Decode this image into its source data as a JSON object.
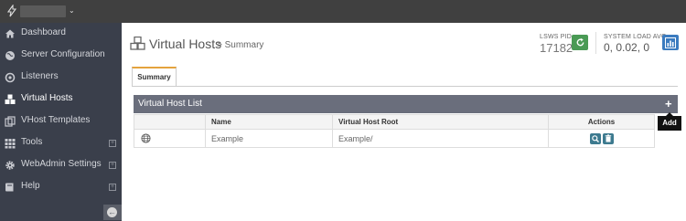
{
  "topbar": {
    "user_name": "",
    "caret": "⌄"
  },
  "sidebar": {
    "items": [
      {
        "label": "Dashboard",
        "icon": "home-icon",
        "expandable": false
      },
      {
        "label": "Server Configuration",
        "icon": "globe-icon",
        "expandable": false
      },
      {
        "label": "Listeners",
        "icon": "link-icon",
        "expandable": false
      },
      {
        "label": "Virtual Hosts",
        "icon": "cubes-icon",
        "expandable": false,
        "active": true
      },
      {
        "label": "VHost Templates",
        "icon": "copy-icon",
        "expandable": false
      },
      {
        "label": "Tools",
        "icon": "grid-icon",
        "expandable": true
      },
      {
        "label": "WebAdmin Settings",
        "icon": "gear-icon",
        "expandable": true
      },
      {
        "label": "Help",
        "icon": "book-icon",
        "expandable": true
      }
    ],
    "expand_glyph": "+",
    "collapse_glyph": "←"
  },
  "header": {
    "title": "Virtual Hosts",
    "subtitle": " > Summary",
    "pid_label": "LSWS PID",
    "pid_value": "17182",
    "load_label": "SYSTEM LOAD AVG",
    "load_value": "0, 0.02, 0"
  },
  "tabs": [
    {
      "label": "Summary",
      "active": true
    }
  ],
  "panel": {
    "title": "Virtual Host List",
    "add_glyph": "+",
    "tooltip": "Add",
    "columns": [
      "",
      "Name",
      "Virtual Host Root",
      "Actions"
    ],
    "rows": [
      {
        "name": "Example",
        "root": "Example/"
      }
    ]
  },
  "colors": {
    "sidebar_bg": "#3a3f4b",
    "topbar_bg": "#404040",
    "panel_head_bg": "#6a6e7c",
    "tab_accent": "#e4a33d",
    "restart_green": "#4a9a55",
    "chart_blue": "#3b7bbf",
    "action_teal": "#3d7a8f"
  }
}
